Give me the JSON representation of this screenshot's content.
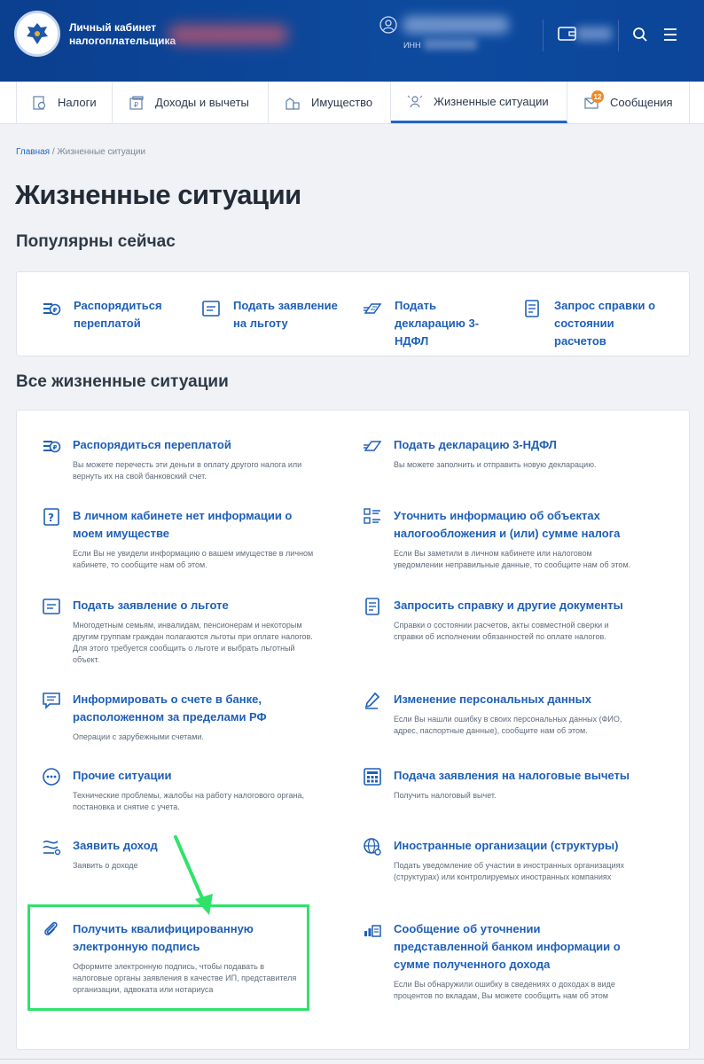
{
  "header": {
    "brand_line1": "Личный кабинет",
    "brand_line2": "налогоплательщика",
    "inn_label": "ИНН"
  },
  "nav": {
    "tabs": [
      {
        "label": "Налоги",
        "icon": "taxes-icon"
      },
      {
        "label": "Доходы и вычеты",
        "icon": "income-icon"
      },
      {
        "label": "Имущество",
        "icon": "property-icon"
      },
      {
        "label": "Жизненные ситуации",
        "icon": "life-situations-icon",
        "active": true
      },
      {
        "label": "Сообщения",
        "icon": "messages-icon",
        "badge": "12"
      }
    ]
  },
  "breadcrumb": {
    "home": "Главная",
    "separator": " / ",
    "current": "Жизненные ситуации"
  },
  "page_title": "Жизненные ситуации",
  "popular": {
    "title": "Популярны сейчас",
    "items": [
      {
        "label": "Распорядиться переплатой",
        "icon": "overpayment-icon"
      },
      {
        "label": "Подать заявление на льготу",
        "icon": "benefit-application-icon"
      },
      {
        "label": "Подать декларацию 3-НДФЛ",
        "icon": "declaration-icon"
      },
      {
        "label": "Запрос справки о состоянии расчетов",
        "icon": "certificate-request-icon"
      }
    ]
  },
  "all": {
    "title": "Все жизненные ситуации",
    "items": [
      {
        "title": "Распорядиться переплатой",
        "desc": "Вы можете перечесть эти деньги в оплату другого налога или вернуть их на свой банковский счет.",
        "icon": "overpayment-icon"
      },
      {
        "title": "Подать декларацию 3-НДФЛ",
        "desc": "Вы можете заполнить и отправить новую декларацию.",
        "icon": "declaration-icon"
      },
      {
        "title": "В личном кабинете нет информации о моем имуществе",
        "desc": "Если Вы не увидели информацию о вашем имуществе в личном кабинете, то сообщите нам об этом.",
        "icon": "question-icon"
      },
      {
        "title": "Уточнить информацию об объектах налогообложения и (или) сумме налога",
        "desc": "Если Вы заметили в личном кабинете или налоговом уведомлении неправильные данные, то сообщите нам об этом.",
        "icon": "checklist-icon"
      },
      {
        "title": "Подать заявление о льготе",
        "desc": "Многодетным семьям, инвалидам, пенсионерам и некоторым другим группам граждан полагаются льготы при оплате налогов. Для этого требуется сообщить о льготе и выбрать льготный объект.",
        "icon": "benefit-application-icon"
      },
      {
        "title": "Запросить справку и другие документы",
        "desc": "Справки о состоянии расчетов, акты совместной сверки и справки об исполнении обязанностей по оплате налогов.",
        "icon": "document-icon"
      },
      {
        "title": "Информировать о счете в банке, расположенном за пределами РФ",
        "desc": "Операции с зарубежными счетами.",
        "icon": "chat-icon"
      },
      {
        "title": "Изменение персональных данных",
        "desc": "Если Вы нашли ошибку в своих персональных данных (ФИО, адрес, паспортные данные), сообщите нам об этом.",
        "icon": "pen-icon"
      },
      {
        "title": "Прочие ситуации",
        "desc": "Технические проблемы, жалобы на работу налогового органа, постановка и снятие с учета.",
        "icon": "more-icon"
      },
      {
        "title": "Подача заявления на налоговые вычеты",
        "desc": "Получить налоговый вычет.",
        "icon": "calculator-icon"
      },
      {
        "title": "Заявить доход",
        "desc": "Заявить о доходе",
        "icon": "declare-income-icon"
      },
      {
        "title": "Иностранные организации (структуры)",
        "desc": "Подать уведомление об участии в иностранных организациях (структурах) или контролируемых иностранных компаниях",
        "icon": "globe-icon"
      },
      {
        "title": "Получить квалифицированную электронную подпись",
        "desc": "Оформите электронную подпись, чтобы подавать в налоговые органы заявления в качестве ИП, представителя организации, адвоката или нотариуса",
        "icon": "paperclip-icon"
      },
      {
        "title": "Сообщение об уточнении представленной банком информации о сумме полученного дохода",
        "desc": "Если Вы обнаружили ошибку в сведениях о доходах в виде процентов по вкладам, Вы можете сообщить нам об этом",
        "icon": "bank-report-icon"
      }
    ]
  },
  "colors": {
    "header_bg": "#0d4a9e",
    "link": "#1e5fb8",
    "highlight": "#2fe36a",
    "badge": "#f08a24"
  }
}
